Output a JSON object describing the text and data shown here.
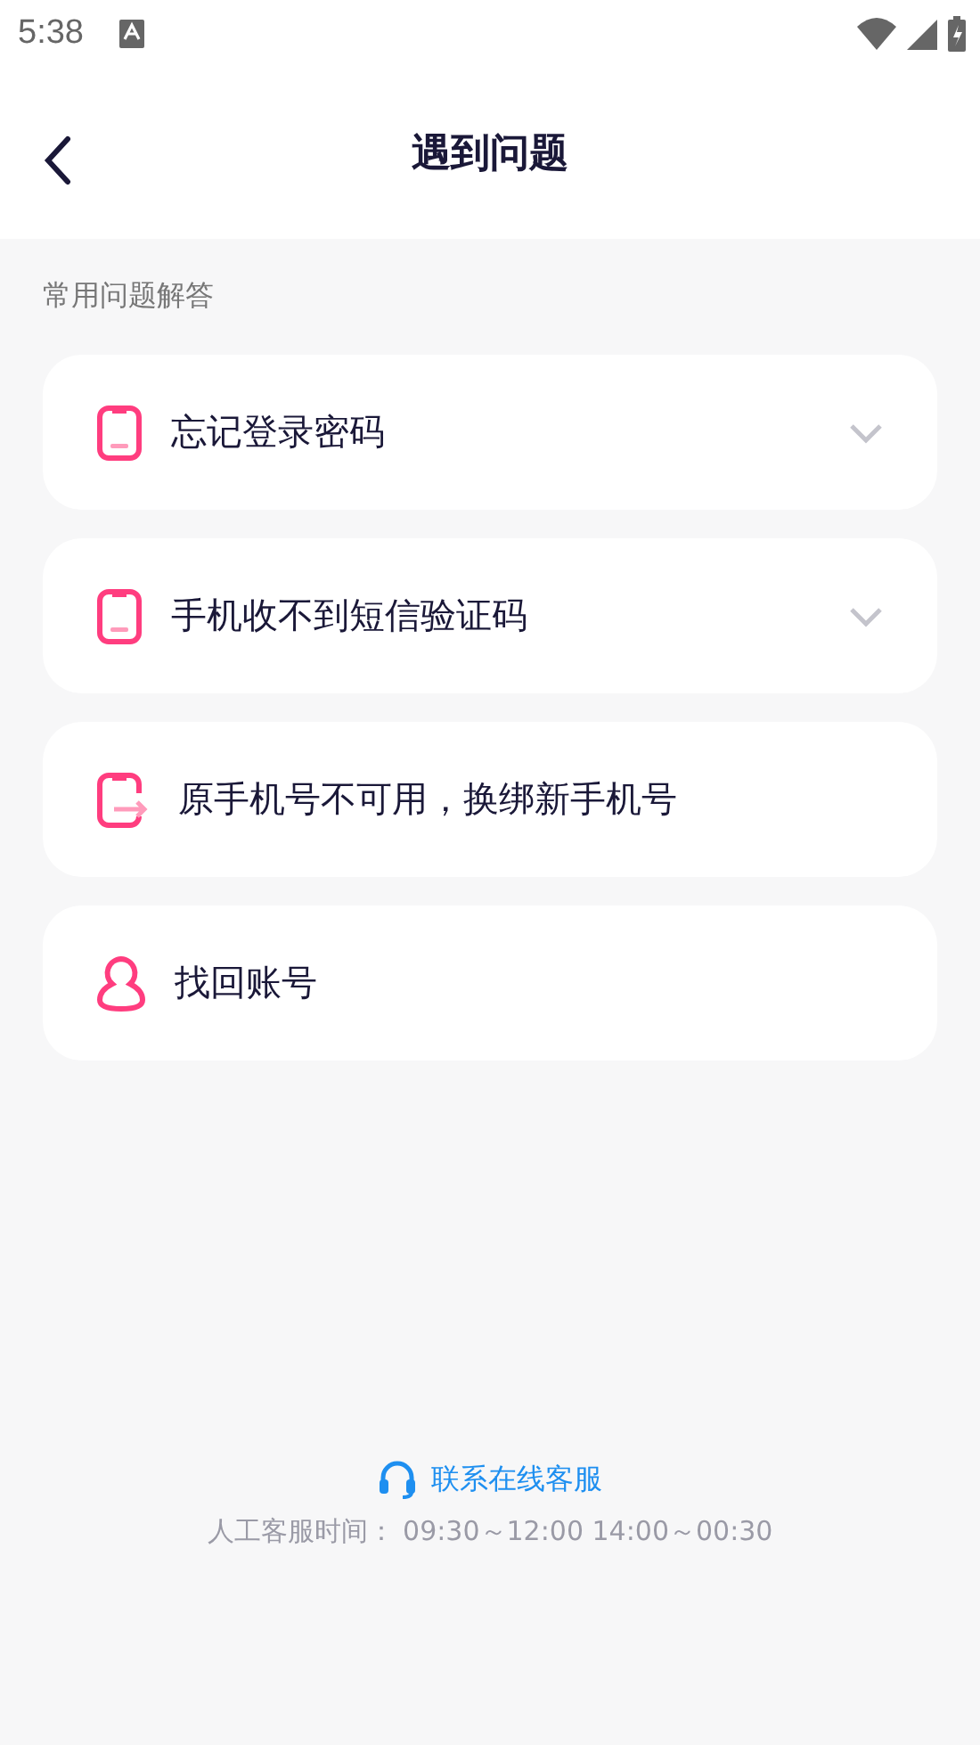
{
  "status_bar": {
    "time": "5:38"
  },
  "header": {
    "title": "遇到问题"
  },
  "section": {
    "title": "常用问题解答"
  },
  "items": [
    {
      "kind": "phone",
      "label": "忘记登录密码",
      "expanded": false
    },
    {
      "kind": "phone",
      "label": "手机收不到短信验证码",
      "expanded": false
    },
    {
      "kind": "phone-transfer",
      "label": "原手机号不可用，换绑新手机号"
    },
    {
      "kind": "person",
      "label": "找回账号"
    }
  ],
  "footer": {
    "link": "联系在线客服",
    "hours": "人工客服时间： 09:30～12:00 14:00～00:30"
  }
}
